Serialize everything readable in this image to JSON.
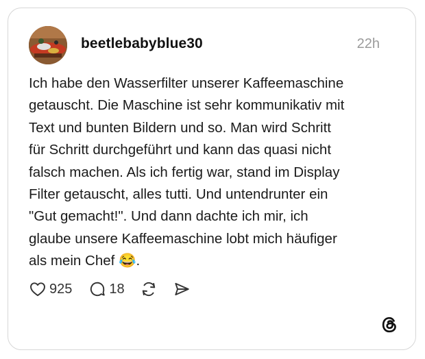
{
  "post": {
    "username": "beetlebabyblue30",
    "timestamp": "22h",
    "text": "Ich habe den Wasserfilter unserer Kaffeemaschine\ngetauscht. Die Maschine ist sehr kommunikativ mit\nText und bunten Bildern und so. Man wird Schritt\nfür Schritt durchgeführt und kann das quasi nicht\nfalsch machen. Als ich fertig war, stand im Display\nFilter getauscht, alles tutti. Und untendrunter ein\n\"Gut gemacht!\". Und dann dachte ich mir, ich\nglaube unsere Kaffeemaschine lobt mich häufiger\nals mein Chef 😂."
  },
  "actions": {
    "likes": "925",
    "comments": "18"
  },
  "icons": {
    "like": "heart-icon",
    "comment": "comment-bubble-icon",
    "repost": "repost-icon",
    "share": "send-icon",
    "brand": "threads-logo-icon"
  }
}
